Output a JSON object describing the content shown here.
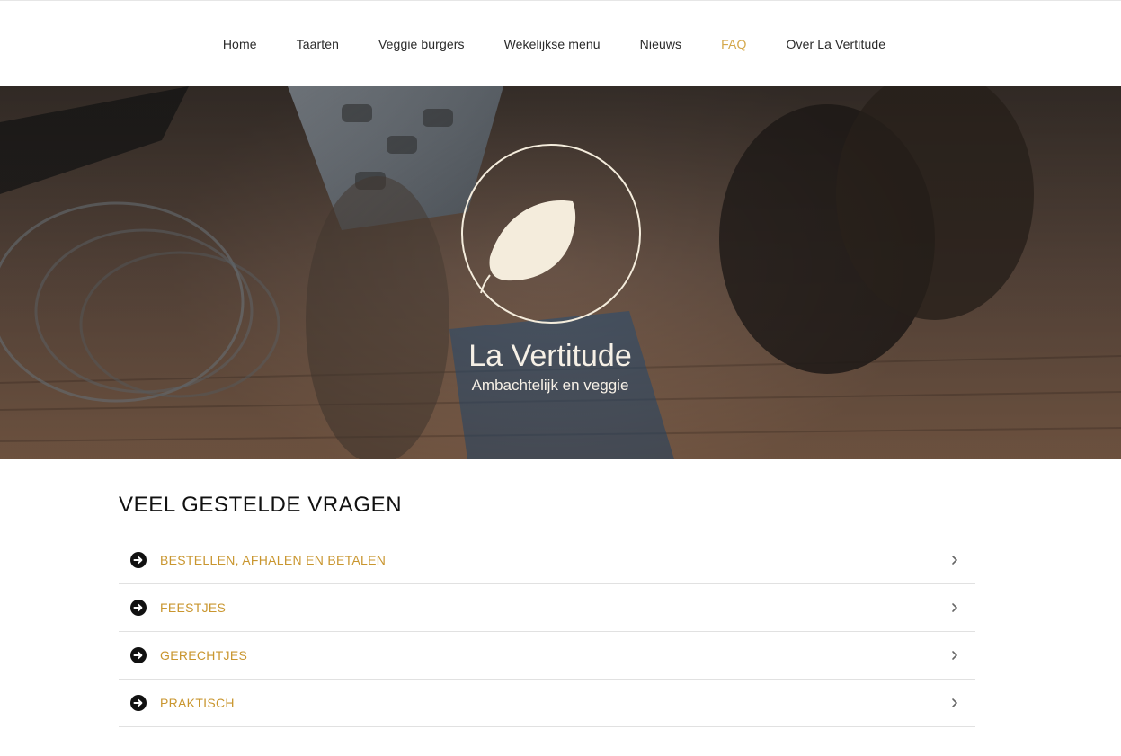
{
  "nav": {
    "items": [
      {
        "label": "Home"
      },
      {
        "label": "Taarten"
      },
      {
        "label": "Veggie burgers"
      },
      {
        "label": "Wekelijkse menu"
      },
      {
        "label": "Nieuws"
      },
      {
        "label": "FAQ"
      },
      {
        "label": "Over La Vertitude"
      }
    ],
    "active": "FAQ"
  },
  "hero": {
    "brand_name": "La Vertitude",
    "tagline": "Ambachtelijk en veggie",
    "logo_icon": "leaf-circle-logo"
  },
  "faq": {
    "title": "VEEL GESTELDE VRAGEN",
    "items": [
      {
        "label": "BESTELLEN, AFHALEN EN BETALEN"
      },
      {
        "label": "FEESTJES"
      },
      {
        "label": "GERECHTJES"
      },
      {
        "label": "PRAKTISCH"
      }
    ],
    "item_icon": "arrow-circle-right-icon",
    "expand_icon": "chevron-right-icon"
  },
  "colors": {
    "accent": "#d4a74a",
    "faq_label": "#c9962f",
    "logo_leaf": "#f4ecdc"
  }
}
